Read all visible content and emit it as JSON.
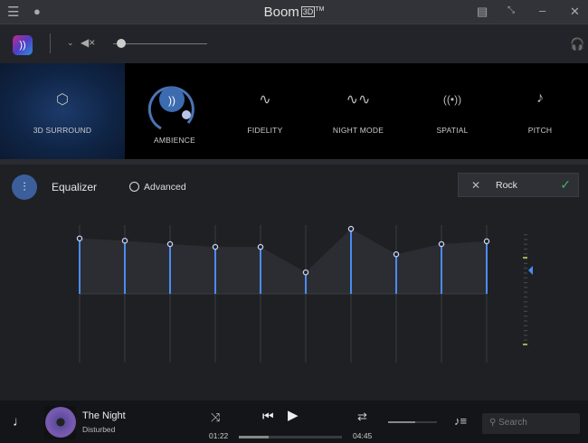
{
  "titlebar": {
    "app_name": "Boom",
    "app_badge": "3D",
    "trademark": "TM",
    "icons": [
      "menu-icon",
      "user-icon",
      "feedback-icon",
      "compact-icon",
      "minimize-icon",
      "close-icon"
    ]
  },
  "toolbar": {
    "volume_fraction": 0.08,
    "muted": true
  },
  "effects": [
    {
      "id": "3d-surround",
      "label": "3D SURROUND",
      "active": true
    },
    {
      "id": "ambience",
      "label": "AMBIENCE"
    },
    {
      "id": "fidelity",
      "label": "FIDELITY"
    },
    {
      "id": "night-mode",
      "label": "NIGHT MODE"
    },
    {
      "id": "spatial",
      "label": "SPATIAL"
    },
    {
      "id": "pitch",
      "label": "PITCH"
    }
  ],
  "equalizer": {
    "title": "Equalizer",
    "advanced_label": "Advanced",
    "preset": "Rock",
    "band_values_db": [
      9.8,
      9.4,
      8.8,
      8.3,
      8.3,
      3.8,
      11.5,
      7.0,
      8.8,
      9.3
    ],
    "range_db": [
      -12,
      12
    ],
    "accent": "#4a8cf0"
  },
  "player": {
    "title": "The Night",
    "artist": "Disturbed",
    "elapsed": "01:22",
    "duration": "04:45",
    "progress": 0.29,
    "volume": 0.55,
    "search_placeholder": "Search"
  }
}
